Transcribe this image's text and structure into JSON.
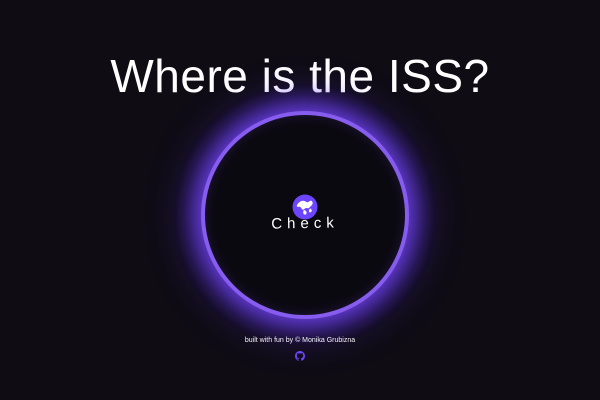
{
  "header": {
    "title": "Where is the ISS?"
  },
  "main": {
    "check_label": "Check",
    "icon": "globe-icon"
  },
  "footer": {
    "credit": "built with fun by © Monika Grubizna",
    "github_icon": "github-icon"
  },
  "colors": {
    "background": "#0f0c14",
    "accent": "#6e45ff",
    "glow": "#8f68ff",
    "text": "#ffffff"
  }
}
